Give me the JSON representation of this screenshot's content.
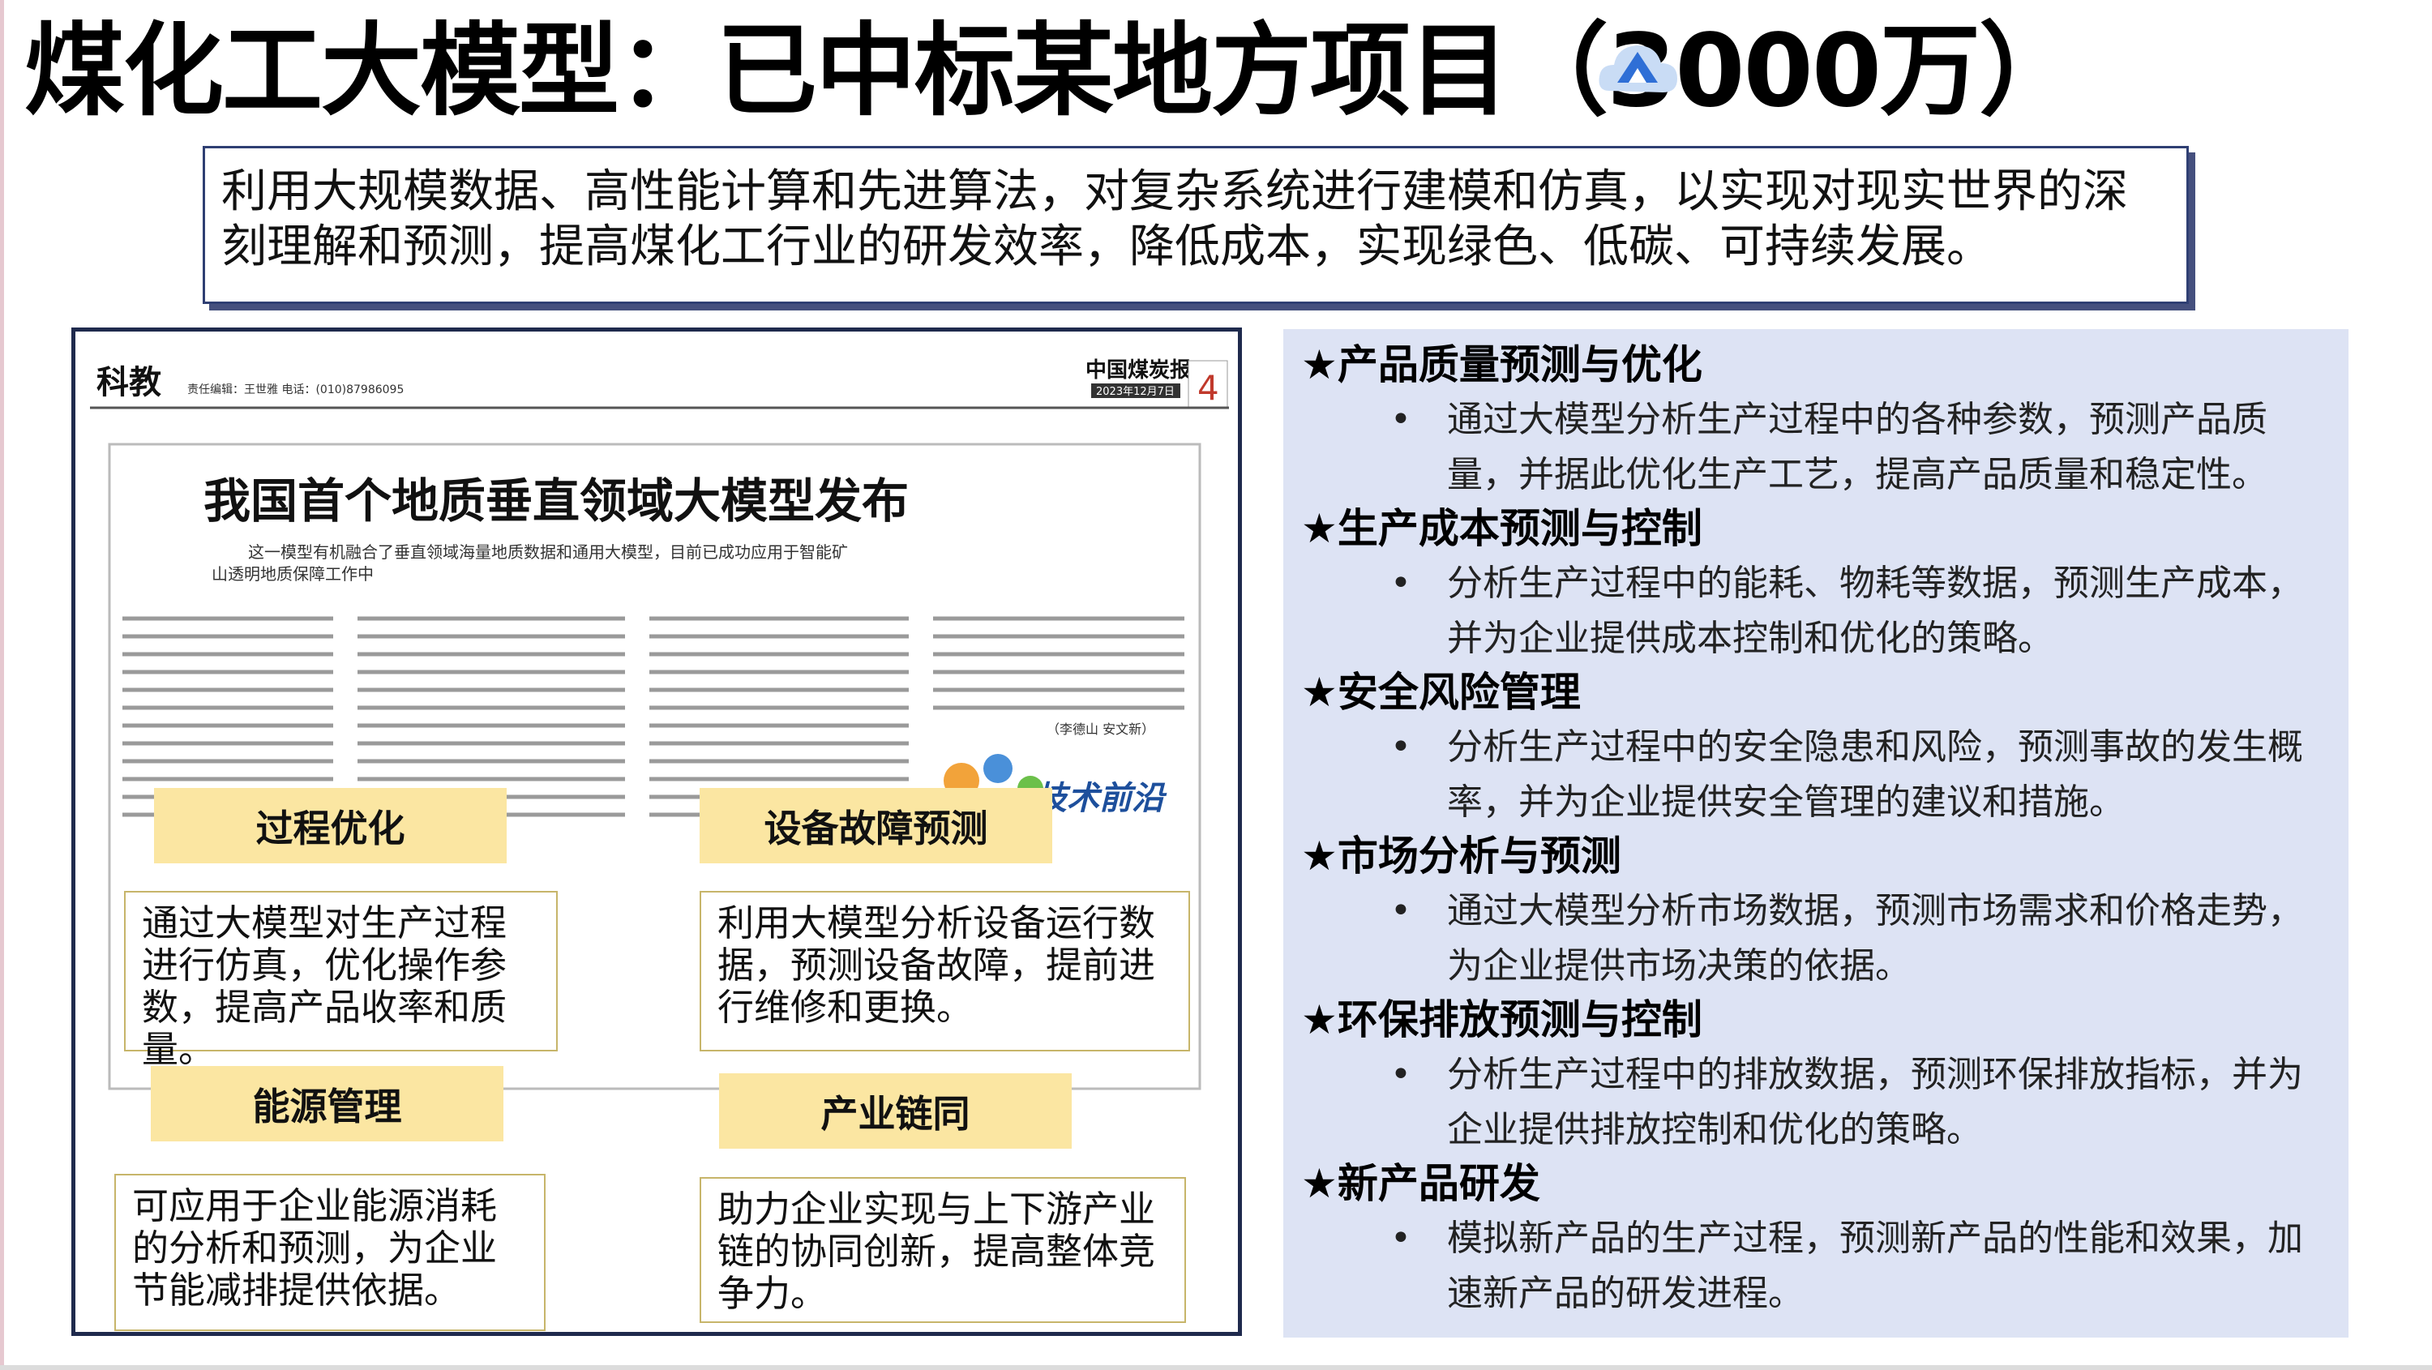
{
  "title": "煤化工大模型：已中标某地方项目（3000万）",
  "summary": "利用大规模数据、高性能计算和先进算法，对复杂系统进行建模和仿真，以实现对现实世界的深刻理解和预测，提高煤化工行业的研发效率，降低成本，实现绿色、低碳、可持续发展。",
  "newspaper": {
    "section": "科教",
    "editor_line": "责任编辑：王世雅  电话：(010)87986095",
    "masthead": "中国煤炭报",
    "date": "2023年12月7日",
    "page_number": "4",
    "headline": "我国首个地质垂直领域大模型发布",
    "subheadline_1": "这一模型有机融合了垂直领域海量地质数据和通用大模型，目前已成功应用于智能矿",
    "subheadline_2": "山透明地质保障工作中",
    "tag": "技术前沿",
    "author": "（李德山  安文新）"
  },
  "cards": [
    {
      "title": "过程优化",
      "text": "通过大模型对生产过程进行仿真，优化操作参数，提高产品收率和质量。"
    },
    {
      "title": "设备故障预测",
      "text": "利用大模型分析设备运行数据，预测设备故障，提前进行维修和更换。"
    },
    {
      "title": "能源管理",
      "text": "可应用于企业能源消耗的分析和预测，为企业节能减排提供依据。"
    },
    {
      "title": "产业链同",
      "text": "助力企业实现与上下游产业链的协同创新，提高整体竞争力。"
    }
  ],
  "sections": [
    {
      "title": "★产品质量预测与优化",
      "bullet": "•",
      "text": "通过大模型分析生产过程中的各种参数，预测产品质量，并据此优化生产工艺，提高产品质量和稳定性。"
    },
    {
      "title": "★生产成本预测与控制",
      "bullet": "•",
      "text": "分析生产过程中的能耗、物耗等数据，预测生产成本，并为企业提供成本控制和优化的策略。"
    },
    {
      "title": "★安全风险管理",
      "bullet": "•",
      "text": "分析生产过程中的安全隐患和风险，预测事故的发生概率，并为企业提供安全管理的建议和措施。"
    },
    {
      "title": "★市场分析与预测",
      "bullet": "•",
      "text": "通过大模型分析市场数据，预测市场需求和价格走势，为企业提供市场决策的依据。"
    },
    {
      "title": "★环保排放预测与控制",
      "bullet": "•",
      "text": "分析生产过程中的排放数据，预测环保排放指标，并为企业提供排放控制和优化的策略。"
    },
    {
      "title": "★新产品研发",
      "bullet": "•",
      "text": "模拟新产品的生产过程，预测新产品的性能和效果，加速新产品的研发进程。"
    }
  ]
}
